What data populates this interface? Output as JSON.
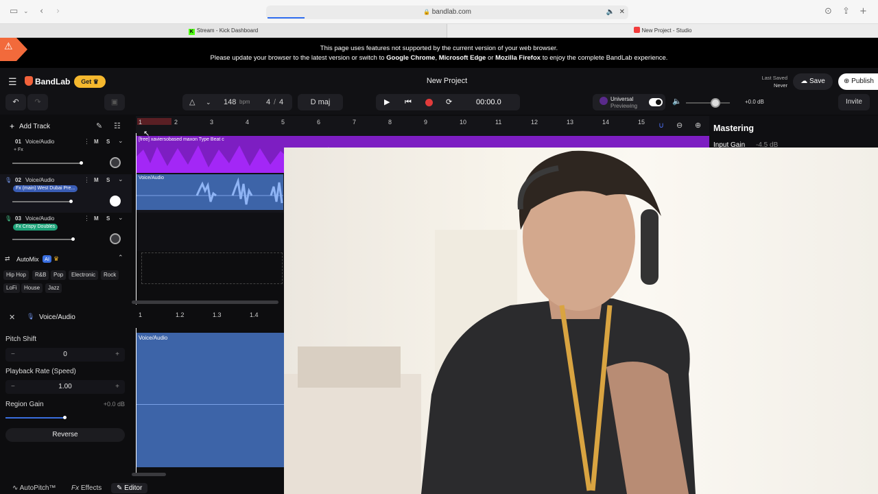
{
  "browser": {
    "url": "bandlab.com",
    "tabs": [
      {
        "label": "Stream - Kick Dashboard"
      },
      {
        "label": "New Project - Studio"
      }
    ]
  },
  "banner": {
    "line1": "This page uses features not supported by the current version of your web browser.",
    "line2_pre": "Please update your browser to the latest version or switch to ",
    "chrome": "Google Chrome",
    "comma": ", ",
    "edge": "Microsoft Edge",
    "or": " or ",
    "firefox": "Mozilla Firefox",
    "line2_post": " to enjoy the complete BandLab experience."
  },
  "header": {
    "logo": "BandLab",
    "get_label": "Get",
    "project_title": "New Project",
    "last_saved_label": "Last Saved",
    "last_saved_value": "Never",
    "save_label": "Save",
    "publish_label": "Publish"
  },
  "toolbar": {
    "bpm_value": "148",
    "bpm_unit": "bpm",
    "time_sig_num": "4",
    "time_sig_den": "4",
    "key": "D maj",
    "time": "00:00.0",
    "universal_label": "Universal",
    "previewing_label": "Previewing",
    "master_volume": "+0.0 dB",
    "invite_label": "Invite"
  },
  "tracks_panel": {
    "add_track_label": "Add Track",
    "tracks": [
      {
        "number": "01",
        "name": "Voice/Audio",
        "fx": "+ Fx"
      },
      {
        "number": "02",
        "name": "Voice/Audio",
        "fx": "Fx (main) West Dubai Pre..."
      },
      {
        "number": "03",
        "name": "Voice/Audio",
        "fx": "Fx Crispy Doubles"
      }
    ],
    "mute_label": "M",
    "solo_label": "S"
  },
  "automix": {
    "title": "AutoMix",
    "ai_badge": "AI",
    "genres": [
      "Hip Hop",
      "R&B",
      "Pop",
      "Electronic",
      "Rock",
      "LoFi",
      "House",
      "Jazz"
    ]
  },
  "ruler": {
    "bars": [
      "1",
      "2",
      "3",
      "4",
      "5",
      "6",
      "7",
      "8",
      "9",
      "10",
      "11",
      "12",
      "13",
      "14",
      "15"
    ]
  },
  "regions": {
    "track1_label": "[free] xaviersobased  maxon Type Beat  c",
    "track2_label": "Voice/Audio"
  },
  "mastering": {
    "title": "Mastering",
    "input_gain_label": "Input Gain",
    "input_gain_value": "-4.5 dB"
  },
  "editor": {
    "track_name": "Voice/Audio",
    "pitch_shift_label": "Pitch Shift",
    "pitch_shift_value": "0",
    "playback_rate_label": "Playback Rate (Speed)",
    "playback_rate_value": "1.00",
    "region_gain_label": "Region Gain",
    "region_gain_value": "+0.0 dB",
    "reverse_label": "Reverse",
    "ruler_ticks": [
      "1",
      "1.2",
      "1.3",
      "1.4"
    ],
    "region_label": "Voice/Audio"
  },
  "bottom_nav": {
    "autopitch": "AutoPitch™",
    "effects": "Effects",
    "editor": "Editor"
  },
  "colors": {
    "accent_orange": "#f2623b",
    "purple_region": "#9b1fe8",
    "blue_region": "#3d64a8",
    "record_red": "#e23b3b"
  }
}
